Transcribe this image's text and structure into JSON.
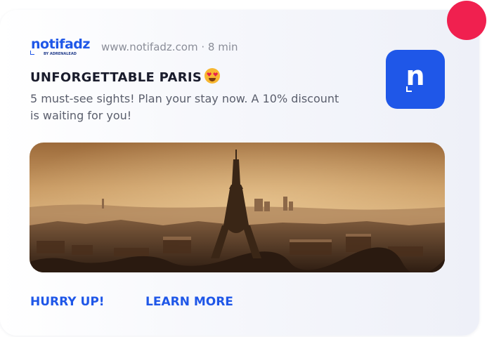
{
  "brand": {
    "name": "notifadz",
    "tagline": "BY ADRENALEAD"
  },
  "notification": {
    "source": "www.notifadz.com · 8 min",
    "title": "UNFORGETTABLE PARIS",
    "emoji": "smiling-face-with-heart-eyes-icon",
    "body": "5 must-see sights! Plan your stay now. A 10% discount is waiting for you!",
    "app_icon_letter": "n",
    "image": "eiffel-tower-sunset-photo"
  },
  "actions": {
    "primary_label": "HURRY UP!",
    "secondary_label": "LEARN MORE"
  },
  "colors": {
    "accent": "#1f57e8",
    "badge": "#f0204f",
    "title": "#1a1c2c",
    "body": "#5a5e6c",
    "meta": "#8a8d98"
  }
}
